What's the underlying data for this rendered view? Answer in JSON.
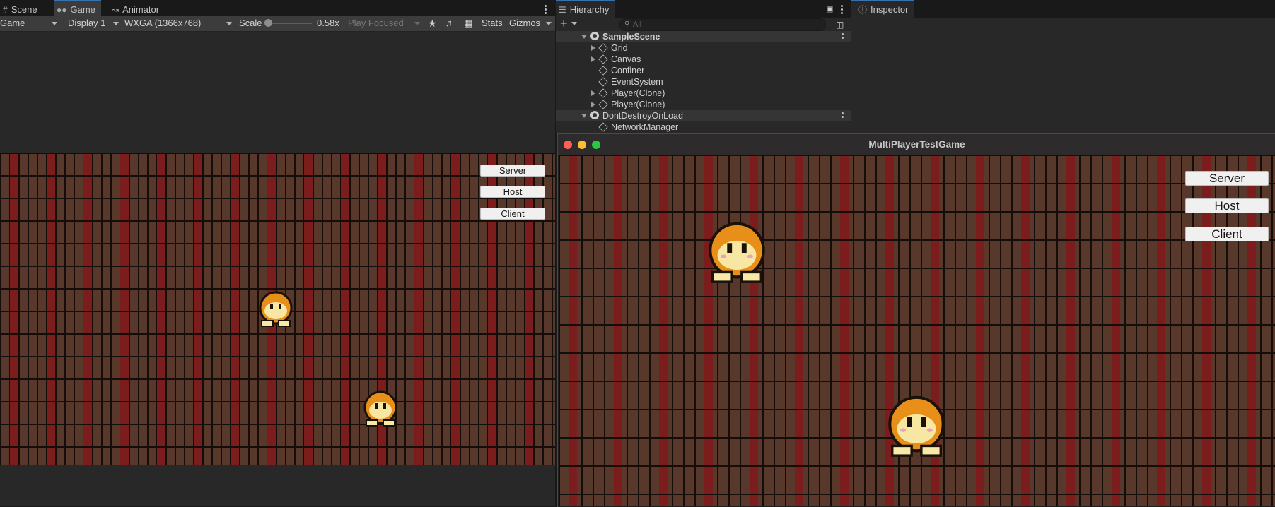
{
  "game_panel": {
    "tabs": [
      {
        "label": "Scene",
        "icon": "grid-icon"
      },
      {
        "label": "Game",
        "icon": "gamepad-icon"
      },
      {
        "label": "Animator",
        "icon": "animator-icon"
      }
    ],
    "toolbar": {
      "mode": "Game",
      "display": "Display 1",
      "resolution": "WXGA (1366x768)",
      "scale_label": "Scale",
      "scale_value": "0.58x",
      "play_mode": "Play Focused",
      "stats": "Stats",
      "gizmos": "Gizmos"
    },
    "buttons": {
      "server": "Server",
      "host": "Host",
      "client": "Client"
    }
  },
  "hierarchy": {
    "tab": "Hierarchy",
    "search_placeholder": "All",
    "rows": [
      {
        "label": "SampleScene",
        "kind": "scene"
      },
      {
        "label": "Grid",
        "kind": "object",
        "expandable": true
      },
      {
        "label": "Canvas",
        "kind": "object",
        "expandable": true
      },
      {
        "label": "Confiner",
        "kind": "object",
        "expandable": false
      },
      {
        "label": "EventSystem",
        "kind": "object",
        "expandable": false
      },
      {
        "label": "Player(Clone)",
        "kind": "object",
        "expandable": true
      },
      {
        "label": "Player(Clone)",
        "kind": "object",
        "expandable": true
      },
      {
        "label": "DontDestroyOnLoad",
        "kind": "scene"
      },
      {
        "label": "NetworkManager",
        "kind": "object",
        "expandable": false
      }
    ]
  },
  "inspector": {
    "tab": "Inspector"
  },
  "window": {
    "title": "MultiPlayerTestGame",
    "buttons": {
      "server": "Server",
      "host": "Host",
      "client": "Client"
    }
  },
  "colors": {
    "accent": "#3a72b0",
    "brick_red": "#7b1d1d",
    "brick_brown": "#57382a",
    "character": "#f2a230"
  }
}
